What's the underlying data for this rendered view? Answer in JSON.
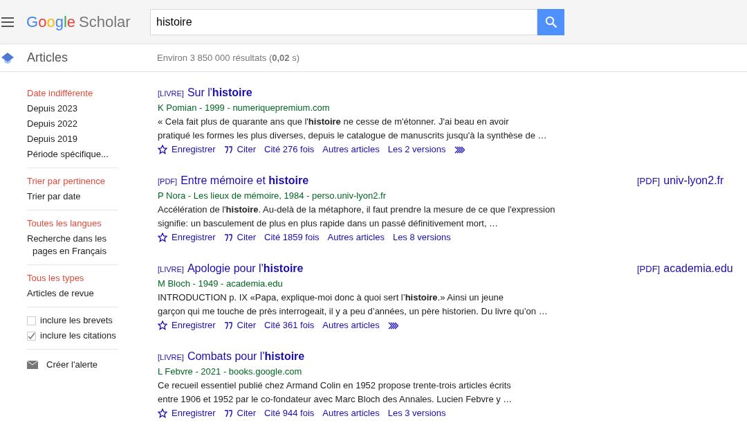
{
  "header": {
    "logo_brand": "Google",
    "logo_product": "Scholar",
    "search": {
      "value": "histoire"
    }
  },
  "subheader": {
    "section": "Articles",
    "stats": "Environ 3 850 000 résultats (**0,02** s)"
  },
  "sidebar": {
    "groups": [
      {
        "kind": "links",
        "items": [
          {
            "label": "Date indifférente",
            "selected": true
          },
          {
            "label": "Depuis 2023",
            "selected": false
          },
          {
            "label": "Depuis 2022",
            "selected": false
          },
          {
            "label": "Depuis 2019",
            "selected": false
          },
          {
            "label": "Période spécifique...",
            "selected": false
          }
        ]
      },
      {
        "kind": "links",
        "items": [
          {
            "label": "Trier par pertinence",
            "selected": true
          },
          {
            "label": "Trier par date",
            "selected": false
          }
        ]
      },
      {
        "kind": "links",
        "items": [
          {
            "label": "Toutes les langues",
            "selected": true
          },
          {
            "label": "Recherche dans les pages en Français",
            "selected": false
          }
        ]
      },
      {
        "kind": "links",
        "items": [
          {
            "label": "Tous les types",
            "selected": true
          },
          {
            "label": "Articles de revue",
            "selected": false
          }
        ]
      },
      {
        "kind": "checkboxes",
        "items": [
          {
            "label": "inclure les brevets",
            "checked": false
          },
          {
            "label": "inclure les citations",
            "checked": true
          }
        ]
      },
      {
        "kind": "alert",
        "items": [
          {
            "label": "Créer l'alerte"
          }
        ]
      }
    ]
  },
  "results": [
    {
      "tag": "[LIVRE]",
      "title": "Sur l'**histoire**",
      "meta": "K Pomian - 1999 - numeriquepremium.com",
      "snippet": [
        "« Cela fait plus de quarante ans que l'**histoire** ne cesse de m'étonner. J'ai beau en avoir",
        "pratiqué les formes les plus diverses, depuis le catalogue de manuscrits jusqu'à la synthèse de …"
      ],
      "actions": [
        {
          "kind": "save",
          "label": "Enregistrer"
        },
        {
          "kind": "cite",
          "label": "Citer"
        },
        {
          "kind": "link",
          "label": "Cité 276 fois"
        },
        {
          "kind": "link",
          "label": "Autres articles"
        },
        {
          "kind": "link",
          "label": "Les 2 versions"
        },
        {
          "kind": "more"
        }
      ]
    },
    {
      "tag": "[PDF]",
      "title": "Entre mémoire et **histoire**",
      "meta": "P Nora - Les lieux de mémoire, 1984 - perso.univ-lyon2.fr",
      "snippet": [
        "Accélération de l'**histoire**. Au-delà de la métaphore, il faut prendre la mesure de ce que l'expression",
        "signifie: un basculement de plus en plus rapide dans un passé définitivement mort, …"
      ],
      "actions": [
        {
          "kind": "save",
          "label": "Enregistrer"
        },
        {
          "kind": "cite",
          "label": "Citer"
        },
        {
          "kind": "link",
          "label": "Cité 1859 fois"
        },
        {
          "kind": "link",
          "label": "Autres articles"
        },
        {
          "kind": "link",
          "label": "Les 8 versions"
        }
      ],
      "side_link": {
        "tag": "[PDF]",
        "domain": "univ-lyon2.fr"
      }
    },
    {
      "tag": "[LIVRE]",
      "title": "Apologie pour l'**histoire**",
      "meta": "M Bloch - 1949 - academia.edu",
      "snippet": [
        "INTRODUCTION p. IX «Papa, explique-moi donc à quoi sert l’**histoire**.» Ainsi un jeune",
        "garçon qui me touche de près interrogeait, il y a peu d’années, un père historien. Du livre qu’on …"
      ],
      "actions": [
        {
          "kind": "save",
          "label": "Enregistrer"
        },
        {
          "kind": "cite",
          "label": "Citer"
        },
        {
          "kind": "link",
          "label": "Cité 361 fois"
        },
        {
          "kind": "link",
          "label": "Autres articles"
        },
        {
          "kind": "more"
        }
      ],
      "side_link": {
        "tag": "[PDF]",
        "domain": "academia.edu"
      }
    },
    {
      "tag": "[LIVRE]",
      "title": "Combats pour l'**histoire**",
      "meta": "L Febvre - 2021 - books.google.com",
      "snippet": [
        "Ce recueil essentiel publié chez Armand Colin en 1952 propose trente-trois articles écrits",
        "entre 1906 et 1952 par le co-fondateur avec Marc Bloch des Annales. Lucien Febvre y …"
      ],
      "actions": [
        {
          "kind": "save",
          "label": "Enregistrer"
        },
        {
          "kind": "cite",
          "label": "Citer"
        },
        {
          "kind": "link",
          "label": "Cité 944 fois"
        },
        {
          "kind": "link",
          "label": "Autres articles"
        },
        {
          "kind": "link",
          "label": "Les 3 versions"
        }
      ]
    }
  ]
}
